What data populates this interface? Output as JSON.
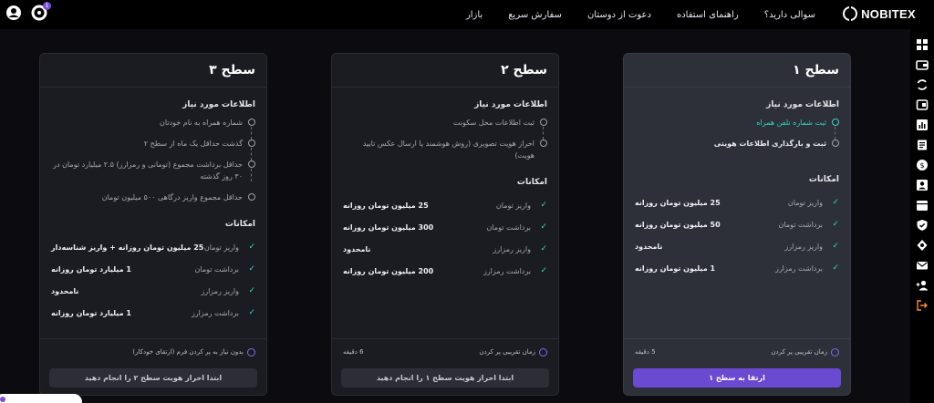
{
  "nav": {
    "logo_text": "NOBITEX",
    "items": [
      "بازار",
      "سفارش سریع",
      "دعوت از دوستان",
      "راهنمای استفاده",
      "سوالی دارید؟"
    ],
    "notification_count": "1"
  },
  "cards": [
    {
      "title": "سطح ۱",
      "current": true,
      "requirements_title": "اطلاعات مورد نیاز",
      "requirements": [
        {
          "text": "ثبت شماره تلفن همراه",
          "done": true
        },
        {
          "text": "ثبت و بارگذاری اطلاعات هویتی",
          "done": false,
          "strong": true
        }
      ],
      "features_title": "امکانات",
      "features": [
        {
          "name": "واریز تومان",
          "value": "25 میلیون تومان روزانه"
        },
        {
          "name": "برداشت تومان",
          "value": "50 میلیون تومان روزانه"
        },
        {
          "name": "واریز رمزارز",
          "value": "نامحدود"
        },
        {
          "name": "برداشت رمزارز",
          "value": "1 میلیون تومان روزانه"
        }
      ],
      "time_label": "زمان تقریبی پر کردن",
      "time_value": "5 دقیقه",
      "button_label": "ارتقا به سطح ۱"
    },
    {
      "title": "سطح ۲",
      "current": false,
      "requirements_title": "اطلاعات مورد نیاز",
      "requirements": [
        {
          "text": "ثبت اطلاعات محل سکونت",
          "done": false
        },
        {
          "text": "احراز هویت تصویری (روش هوشمند یا ارسال عکس تایید هویت)",
          "done": false
        }
      ],
      "features_title": "امکانات",
      "features": [
        {
          "name": "واریز تومان",
          "value": "25 میلیون تومان روزانه"
        },
        {
          "name": "برداشت تومان",
          "value": "300 میلیون تومان روزانه"
        },
        {
          "name": "واریز رمزارز",
          "value": "نامحدود"
        },
        {
          "name": "برداشت رمزارز",
          "value": "200 میلیون تومان روزانه"
        }
      ],
      "time_label": "زمان تقریبی پر کردن",
      "time_value": "6 دقیقه",
      "button_label": "ابتدا احراز هویت سطح ۱ را انجام دهید"
    },
    {
      "title": "سطح ۳",
      "current": false,
      "requirements_title": "اطلاعات مورد نیاز",
      "requirements": [
        {
          "text": "شماره همراه به نام خودتان",
          "done": false
        },
        {
          "text": "گذشت حداقل یک ماه از سطح ۲",
          "done": false
        },
        {
          "text": "حداقل برداشت مجموع (تومانی و رمزارز) ۲.۵ میلیارد تومان در ۳۰ روز گذشته",
          "done": false
        },
        {
          "text": "حداقل مجموع واریز درگاهی ۵۰۰ میلیون تومان",
          "done": false
        }
      ],
      "features_title": "امکانات",
      "features": [
        {
          "name": "واریز تومان",
          "value": "25 میلیون تومان روزانه + واریز شناسه‌دار"
        },
        {
          "name": "برداشت تومان",
          "value": "1 میلیارد تومان روزانه"
        },
        {
          "name": "واریز رمزارز",
          "value": "نامحدود"
        },
        {
          "name": "برداشت رمزارز",
          "value": "1 میلیارد تومان روزانه"
        }
      ],
      "time_label": "بدون نیاز به پر کردن فرم (ارتقای خودکار)",
      "time_value": "",
      "button_label": "ابتدا احراز هویت سطح ۲ را انجام دهید"
    }
  ],
  "sidebar_icons": [
    "dashboard-icon",
    "wallet-icon",
    "exchange-icon",
    "portfolio-icon",
    "chart-icon",
    "orders-icon",
    "coin-icon",
    "profile-icon",
    "calendar-icon",
    "security-icon",
    "settings-icon",
    "mail-icon",
    "add-user-icon",
    "logout-icon"
  ],
  "colors": {
    "accent": "#6a4ad1",
    "done": "#2fd6c9",
    "logout": "#ff8a3c"
  }
}
